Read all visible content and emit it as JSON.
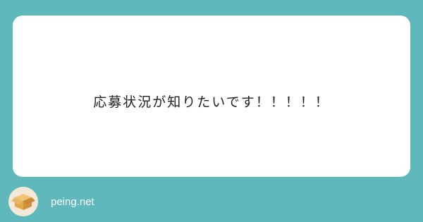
{
  "question": {
    "text": "応募状況が知りたいです！！！！！"
  },
  "footer": {
    "brand": "peing.net",
    "logo_icon": "cardboard-box-icon"
  },
  "colors": {
    "background": "#5fb8bb",
    "card": "#ffffff",
    "text": "#222222",
    "brand_text": "#ffffff",
    "box": "#e3a94f"
  }
}
